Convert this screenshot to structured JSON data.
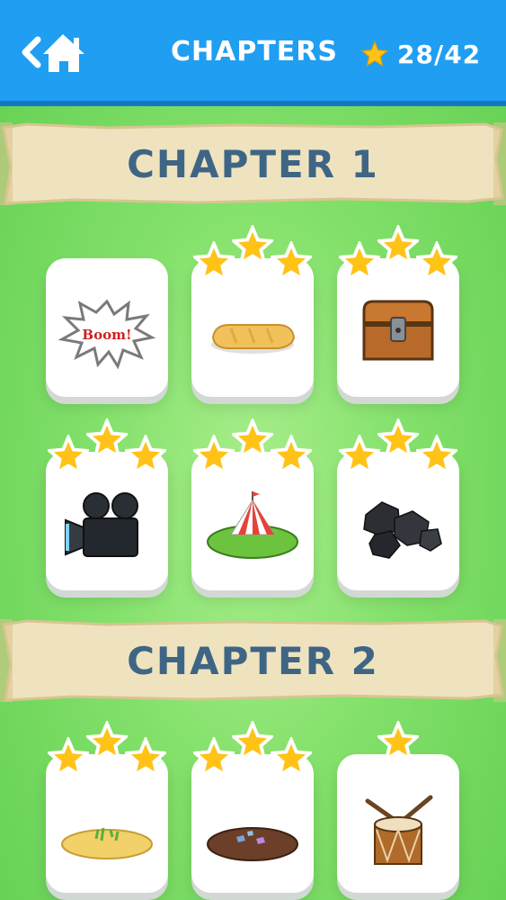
{
  "header": {
    "title": "CHAPTERS",
    "stars_count": "28/42",
    "back_icon": "back-home-icon",
    "star_icon": "star-icon"
  },
  "chapters": [
    {
      "label": "CHAPTER 1",
      "levels": [
        {
          "item": "boom-comic",
          "art_text": "Boom!",
          "stars": 0
        },
        {
          "item": "bread-loaf",
          "stars": 3
        },
        {
          "item": "treasure-chest",
          "stars": 3
        },
        {
          "item": "film-camera",
          "stars": 3
        },
        {
          "item": "circus-tent",
          "stars": 3
        },
        {
          "item": "coal-rocks",
          "stars": 3
        }
      ]
    },
    {
      "label": "CHAPTER 2",
      "levels": [
        {
          "item": "sand-island",
          "stars": 3
        },
        {
          "item": "mud-patch",
          "stars": 3
        },
        {
          "item": "drum",
          "stars": 1
        }
      ]
    }
  ],
  "colors": {
    "topbar": "#1f9ef2",
    "banner": "#efe3bf",
    "banner_text": "#3f6585",
    "star": "#ffc318",
    "background": "#82e06a"
  }
}
